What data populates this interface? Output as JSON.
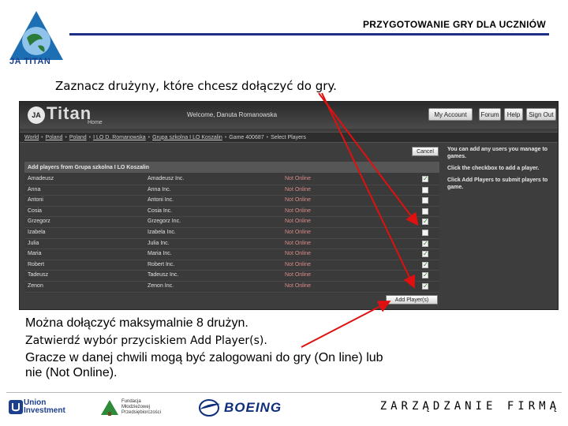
{
  "slide": {
    "title": "PRZYGOTOWANIE GRY DLA UCZNIÓW",
    "logo_caption": "JA TITAN",
    "instruction_select": "Zaznacz drużyny, które chcesz dołączyć do gry.",
    "max_teams_text": "Można dołączyć maksymalnie 8 drużyn.",
    "confirm_text": "Zatwierdź wybór przyciskiem Add Player(s).",
    "online_text": "Gracze w danej chwili mogą być zalogowani do gry (On line) lub nie (Not Online).",
    "footer_right": "ZARZĄDZANIE FIRMĄ"
  },
  "footer_logos": {
    "union": [
      "Union",
      "Investment"
    ],
    "fundacja": [
      "Fundacja",
      "Młodzieżowej",
      "Przedsiębiorczości"
    ],
    "boeing": "BOEING"
  },
  "app": {
    "logo_badge": "JA",
    "logo_text": "Titan",
    "logo_sub": "Home",
    "welcome": "Welcome, Danuta Romanowska",
    "buttons": [
      "My Account",
      "Forum",
      "Help",
      "Sign Out"
    ],
    "breadcrumb": [
      "World",
      "Poland",
      "Poland",
      "I LO D. Romanowska",
      "Grupa szkolna I LO Koszalin",
      "Game 400687",
      "Select Players"
    ],
    "cancel_label": "Cancel",
    "panel_title": "Add players from Grupa szkolna I LO Koszalin",
    "players": [
      {
        "name": "Amadeusz",
        "team": "Amadeusz Inc.",
        "status": "Not Online",
        "checked": true
      },
      {
        "name": "Anna",
        "team": "Anna Inc.",
        "status": "Not Online",
        "checked": false
      },
      {
        "name": "Antoni",
        "team": "Antoni Inc.",
        "status": "Not Online",
        "checked": false
      },
      {
        "name": "Cosia",
        "team": "Cosia Inc.",
        "status": "Not Online",
        "checked": false
      },
      {
        "name": "Grzegorz",
        "team": "Grzegorz Inc.",
        "status": "Not Online",
        "checked": true
      },
      {
        "name": "Izabela",
        "team": "Izabela Inc.",
        "status": "Not Online",
        "checked": false
      },
      {
        "name": "Julia",
        "team": "Julia Inc.",
        "status": "Not Online",
        "checked": true
      },
      {
        "name": "Maria",
        "team": "Maria Inc.",
        "status": "Not Online",
        "checked": true
      },
      {
        "name": "Robert",
        "team": "Robert Inc.",
        "status": "Not Online",
        "checked": true
      },
      {
        "name": "Tadeusz",
        "team": "Tadeusz Inc.",
        "status": "Not Online",
        "checked": true
      },
      {
        "name": "Zenon",
        "team": "Zenon Inc.",
        "status": "Not Online",
        "checked": true
      }
    ],
    "add_button_label": "Add Player(s)",
    "help": [
      "You can add any users you manage to games.",
      "Click the checkbox to add a player.",
      "Click Add Players to submit players to game."
    ]
  },
  "colors": {
    "accent_rule": "#1b2f86",
    "arrow": "#e01010",
    "status_not_online": "#d98a8a"
  }
}
